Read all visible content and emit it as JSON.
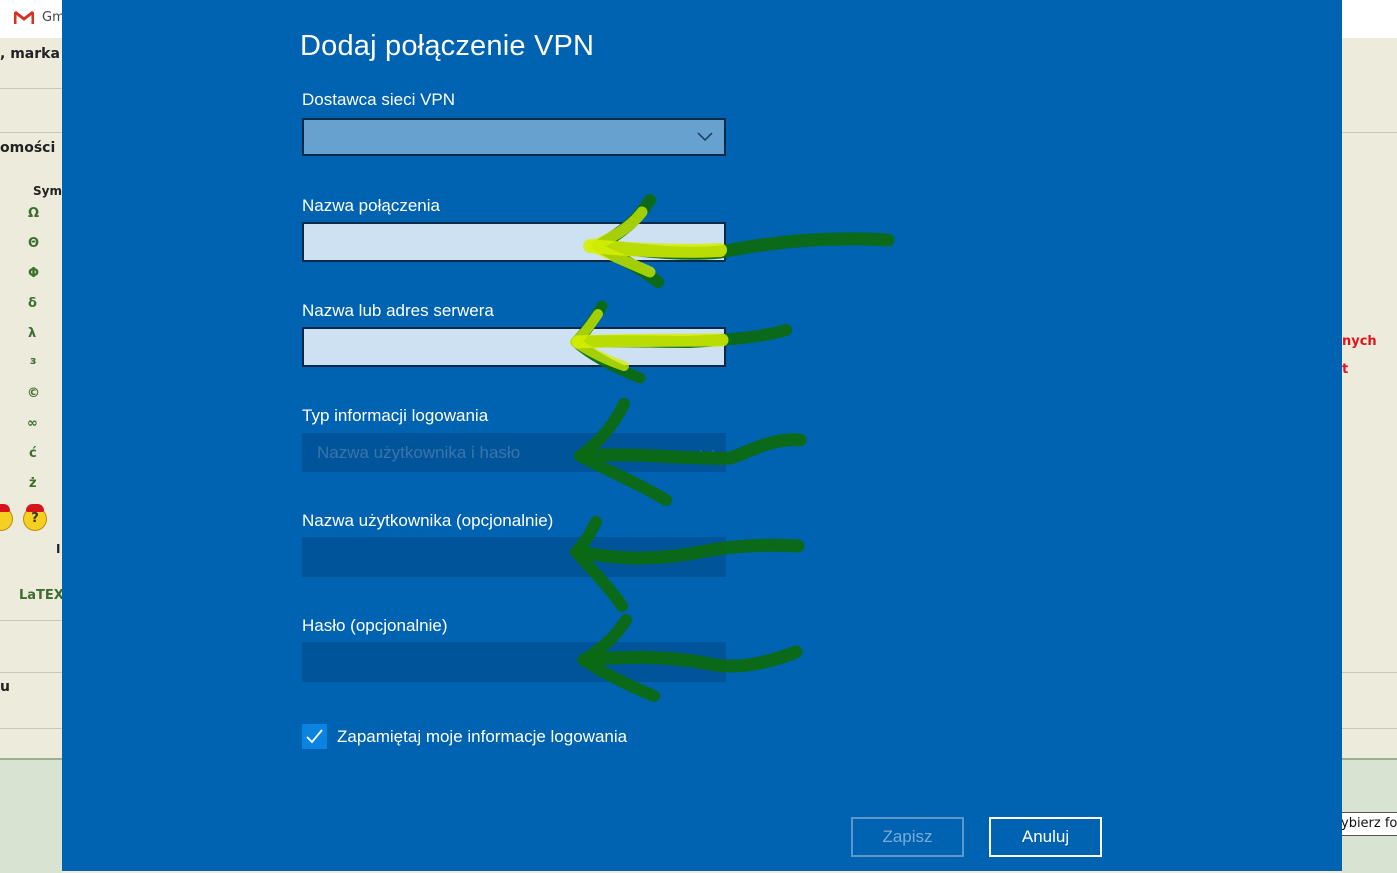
{
  "browser": {
    "tab_title": "Gm",
    "left_snippets": ", marka",
    "left_heading": "omości",
    "sym_header": "Sym",
    "symbols": [
      "Ω",
      "Θ",
      "Φ",
      "δ",
      "λ",
      "з",
      "©",
      "∞",
      "ć",
      "ż"
    ],
    "left_small": "I",
    "latex_label": "LaTEX",
    "left_u": "u",
    "right_red_1": "nych",
    "right_red_2": "t",
    "select_partial": "ybierz fo",
    "emoji_mark": "?"
  },
  "dialog": {
    "title": "Dodaj połączenie VPN",
    "provider_label": "Dostawca sieci VPN",
    "provider_value": "",
    "connection_name_label": "Nazwa połączenia",
    "server_label": "Nazwa lub adres serwera",
    "login_type_label": "Typ informacji logowania",
    "login_type_value": "Nazwa użytkownika i hasło",
    "username_label": "Nazwa użytkownika (opcjonalnie)",
    "password_label": "Hasło (opcjonalnie)",
    "remember_label": "Zapamiętaj moje informacje logowania",
    "remember_checked": true,
    "save_label": "Zapisz",
    "cancel_label": "Anuluj"
  },
  "colors": {
    "dialog_bg": "#0063b1",
    "annotation_green": "#0b6a12",
    "annotation_yellow": "#d6f000"
  }
}
